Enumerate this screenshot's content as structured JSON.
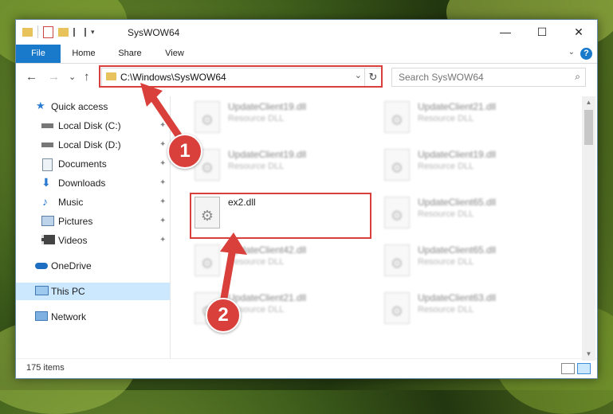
{
  "window": {
    "title": "SysWOW64",
    "minimize_glyph": "—",
    "maximize_glyph": "☐",
    "close_glyph": "✕"
  },
  "ribbon": {
    "tabs": [
      "File",
      "Home",
      "Share",
      "View"
    ],
    "help_glyph": "?",
    "collapse_glyph": "⌄"
  },
  "navigation": {
    "back_glyph": "←",
    "forward_glyph": "→",
    "recent_glyph": "⌄",
    "up_glyph": "↑",
    "address_path": "C:\\Windows\\SysWOW64",
    "refresh_glyph": "↻",
    "search_placeholder": "Search SysWOW64"
  },
  "sidebar": {
    "items": [
      {
        "label": "Quick access",
        "icon": "star-icon",
        "pinned": false
      },
      {
        "label": "Local Disk (C:)",
        "icon": "drive-icon",
        "pinned": true
      },
      {
        "label": "Local Disk (D:)",
        "icon": "drive-icon",
        "pinned": true
      },
      {
        "label": "Documents",
        "icon": "document-icon",
        "pinned": true
      },
      {
        "label": "Downloads",
        "icon": "download-icon",
        "pinned": true
      },
      {
        "label": "Music",
        "icon": "music-icon",
        "pinned": true
      },
      {
        "label": "Pictures",
        "icon": "picture-icon",
        "pinned": true
      },
      {
        "label": "Videos",
        "icon": "video-icon",
        "pinned": true
      },
      {
        "label": "OneDrive",
        "icon": "cloud-icon",
        "pinned": false
      },
      {
        "label": "This PC",
        "icon": "computer-icon",
        "pinned": false,
        "selected": true
      },
      {
        "label": "Network",
        "icon": "network-icon",
        "pinned": false
      }
    ],
    "pin_glyph": "📌"
  },
  "files": [
    {
      "name": "UpdateClient19.dll",
      "type": "Resource DLL",
      "blurred": true
    },
    {
      "name": "UpdateClient21.dll",
      "type": "Resource DLL",
      "blurred": true
    },
    {
      "name": "UpdateClient19.dll",
      "type": "Resource DLL",
      "blurred": true
    },
    {
      "name": "UpdateClient19.dll",
      "type": "Resource DLL",
      "blurred": true
    },
    {
      "name": "ex2.dll",
      "type": "",
      "blurred": false
    },
    {
      "name": "UpdateClient65.dll",
      "type": "Resource DLL",
      "blurred": true
    },
    {
      "name": "UpdateClient42.dll",
      "type": "Resource DLL",
      "blurred": true
    },
    {
      "name": "UpdateClient65.dll",
      "type": "Resource DLL",
      "blurred": true
    },
    {
      "name": "UpdateClient21.dll",
      "type": "Resource DLL",
      "blurred": true
    },
    {
      "name": "UpdateClient63.dll",
      "type": "Resource DLL",
      "blurred": true
    }
  ],
  "status": {
    "item_count": "175 items"
  },
  "callouts": {
    "step1": "1",
    "step2": "2"
  },
  "colors": {
    "accent": "#1979ca",
    "highlight": "#d9403c",
    "selected_bg": "#cce8ff"
  }
}
